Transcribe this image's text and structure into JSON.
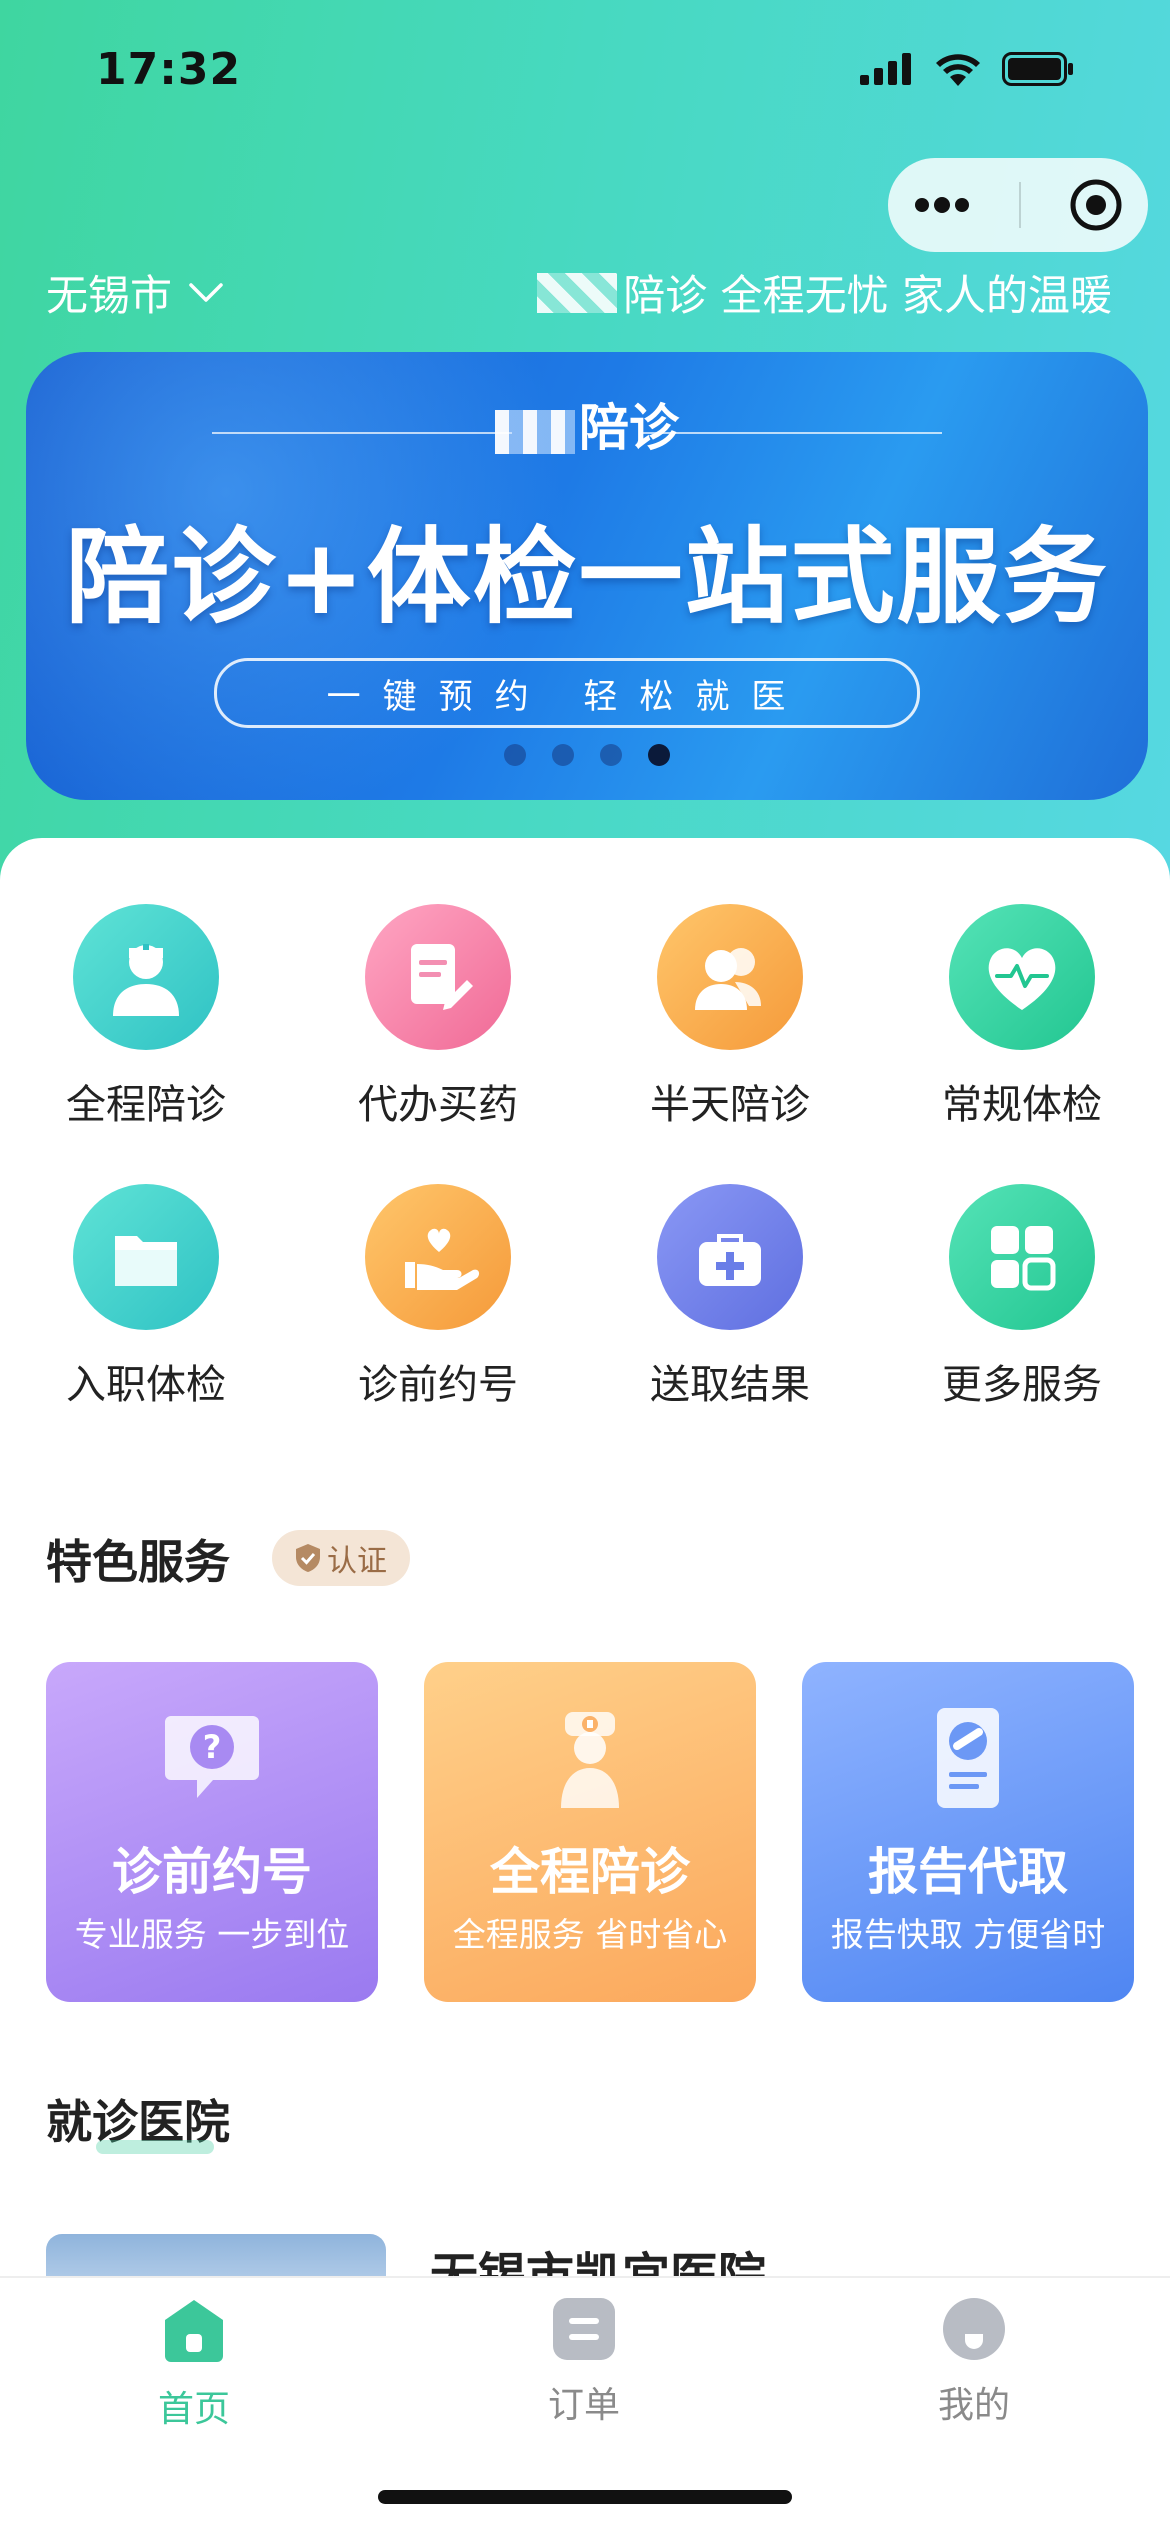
{
  "status_bar": {
    "time": "17:32"
  },
  "header": {
    "city": "无锡市",
    "slogan": "陪诊 全程无忧 家人的温暖"
  },
  "banner": {
    "brand": "陪诊",
    "headline": "陪诊+体检一站式服务",
    "tagline": "一键预约 轻松就医",
    "page_count": 4,
    "active_page": 4
  },
  "services": [
    {
      "label": "全程陪诊",
      "icon": "nurse-icon",
      "color": "#3fcfc4"
    },
    {
      "label": "代办买药",
      "icon": "document-pen-icon",
      "color": "#f47fa6"
    },
    {
      "label": "半天陪诊",
      "icon": "people-icon",
      "color": "#f6a646"
    },
    {
      "label": "常规体检",
      "icon": "heart-pulse-icon",
      "color": "#33d1a0"
    },
    {
      "label": "入职体检",
      "icon": "folder-icon",
      "color": "#3ccdd0"
    },
    {
      "label": "诊前约号",
      "icon": "hand-heart-icon",
      "color": "#f6a646"
    },
    {
      "label": "送取结果",
      "icon": "medical-kit-icon",
      "color": "#6a7ee8"
    },
    {
      "label": "更多服务",
      "icon": "grid-icon",
      "color": "#33d1a0"
    }
  ],
  "featured": {
    "title": "特色服务",
    "badge": "认证",
    "cards": [
      {
        "title": "诊前约号",
        "subtitle": "专业服务 一步到位",
        "icon": "question-bubble-icon"
      },
      {
        "title": "全程陪诊",
        "subtitle": "全程服务 省时省心",
        "icon": "nurse-icon"
      },
      {
        "title": "报告代取",
        "subtitle": "报告快取 方便省时",
        "icon": "report-icon"
      }
    ]
  },
  "hospitals": {
    "title": "就诊医院",
    "first_name": "无锡市凯宜医院"
  },
  "tabbar": {
    "items": [
      {
        "label": "首页",
        "icon": "home-icon",
        "active": true
      },
      {
        "label": "订单",
        "icon": "order-icon",
        "active": false
      },
      {
        "label": "我的",
        "icon": "profile-icon",
        "active": false
      }
    ]
  },
  "colors": {
    "accent": "#3cc79a",
    "hero_start": "#3fd6a0",
    "hero_end": "#56d8e2"
  }
}
